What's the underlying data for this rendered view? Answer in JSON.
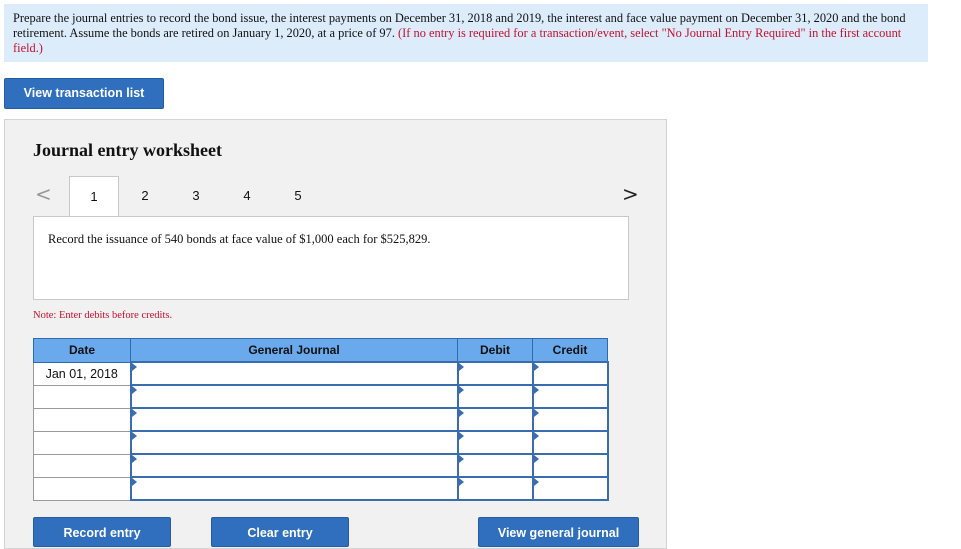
{
  "instructions": {
    "main": "Prepare the journal entries to record the bond issue, the interest payments on December 31, 2018 and 2019,  the interest and face value payment on December 31, 2020 and the bond retirement. Assume the bonds are retired on January 1, 2020, at a price of  97.",
    "note": "(If no entry is required for a transaction/event, select \"No Journal Entry Required\" in the first account field.)"
  },
  "buttons": {
    "view_transaction_list": "View transaction list",
    "record_entry": "Record entry",
    "clear_entry": "Clear entry",
    "view_general_journal": "View general journal"
  },
  "worksheet": {
    "title": "Journal entry worksheet",
    "prev_arrow": "<",
    "next_arrow": ">",
    "tabs": [
      "1",
      "2",
      "3",
      "4",
      "5"
    ],
    "active_tab": "1",
    "description": "Record the issuance of 540 bonds at face value of $1,000 each for $525,829.",
    "note": "Note: Enter debits before credits."
  },
  "journal": {
    "columns": [
      "Date",
      "General Journal",
      "Debit",
      "Credit"
    ],
    "rows": [
      {
        "date": "Jan 01, 2018"
      },
      {
        "date": ""
      },
      {
        "date": ""
      },
      {
        "date": ""
      },
      {
        "date": ""
      },
      {
        "date": ""
      }
    ]
  },
  "colors": {
    "accent": "#2f6fbd",
    "header_bg": "#6aa9ec",
    "instruction_bg": "#dcecfb",
    "note_red": "#c8102e"
  }
}
